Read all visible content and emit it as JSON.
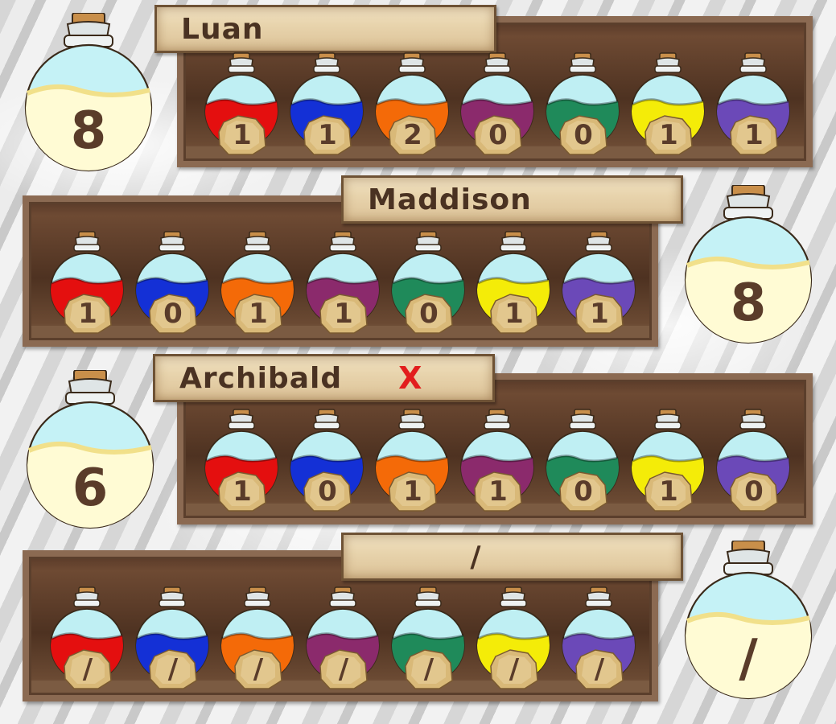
{
  "potion_colors": [
    "#e40f0f",
    "#1430d6",
    "#f46a08",
    "#8b2a6c",
    "#1f8a5a",
    "#f4ec08",
    "#6b49b8"
  ],
  "players": [
    {
      "name": "Luan",
      "mark": "",
      "total": "8",
      "counts": [
        "1",
        "1",
        "2",
        "0",
        "0",
        "1",
        "1"
      ]
    },
    {
      "name": "Maddison",
      "mark": "",
      "total": "8",
      "counts": [
        "1",
        "0",
        "1",
        "1",
        "0",
        "1",
        "1"
      ]
    },
    {
      "name": "Archibald",
      "mark": "X",
      "total": "6",
      "counts": [
        "1",
        "0",
        "1",
        "1",
        "0",
        "1",
        "0"
      ]
    },
    {
      "name": "/",
      "mark": "",
      "total": "/",
      "counts": [
        "/",
        "/",
        "/",
        "/",
        "/",
        "/",
        "/"
      ]
    }
  ],
  "icons": {
    "potion": "potion-bottle-icon",
    "stone": "parchment-stone-icon",
    "total": "big-potion-icon"
  }
}
